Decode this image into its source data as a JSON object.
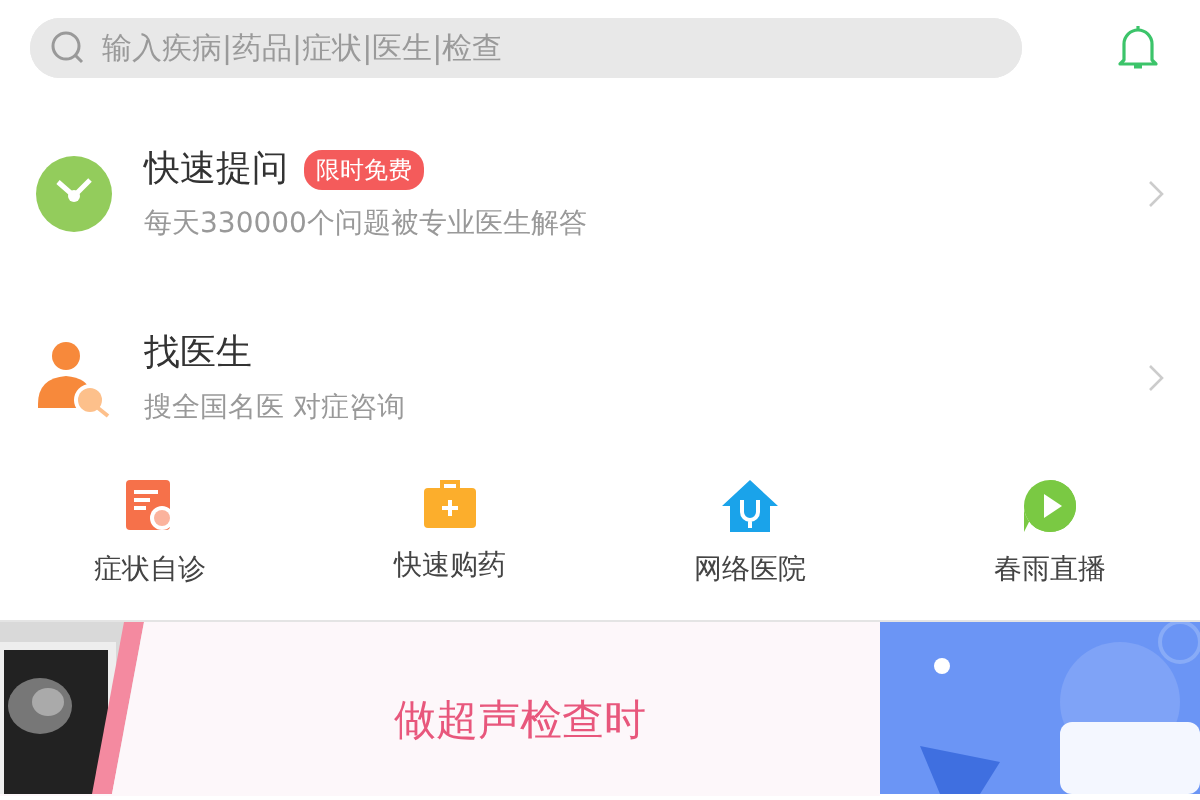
{
  "search": {
    "placeholder": "输入疾病|药品|症状|医生|检查"
  },
  "services": [
    {
      "kind": "ask",
      "title": "快速提问",
      "badge": "限时免费",
      "subtitle": "每天330000个问题被专业医生解答"
    },
    {
      "kind": "doctor",
      "title": "找医生",
      "subtitle": "搜全国名医 对症咨询"
    }
  ],
  "shortcuts": [
    {
      "kind": "symptom",
      "label": "症状自诊"
    },
    {
      "kind": "medicine",
      "label": "快速购药"
    },
    {
      "kind": "hospital",
      "label": "网络医院"
    },
    {
      "kind": "live",
      "label": "春雨直播"
    }
  ],
  "banner": {
    "headline": "做超声检查时"
  }
}
